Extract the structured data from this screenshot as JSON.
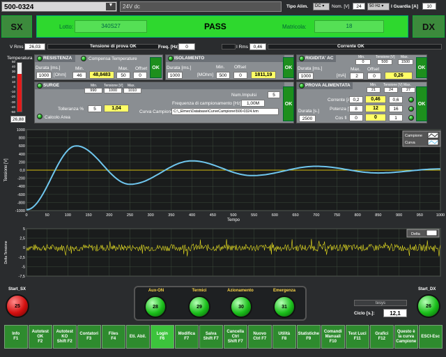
{
  "top": {
    "code": "500-0324",
    "supply": "24V dc",
    "tipo_label": "Tipo Alim.",
    "tipo_val": "DC",
    "nom_label": "Nom. [V]",
    "nom_val": "24",
    "freq_val": "50 Hz",
    "guard_label": "I Guardia [A]",
    "guard_val": "10"
  },
  "bar": {
    "sx": "SX",
    "dx": "DX",
    "lotto_label": "Lotto:",
    "lotto_val": "340S27",
    "result": "PASS",
    "matricola_label": "Matricola:",
    "matricola_val": "18"
  },
  "row3": {
    "vrms_label": "V Rms",
    "vrms_val": "26,03",
    "tens_ok": "Tensione di prova OK",
    "freq_label": "Freq. [Hz]",
    "freq_val": "0",
    "irms_label": "I Rms",
    "irms_val": "0,46",
    "corr_ok": "Corrente OK"
  },
  "temp": {
    "label": "Temperatura",
    "ticks": [
      "50",
      "40",
      "30",
      "20",
      "10",
      "0",
      "-10",
      "-20",
      "-30",
      "-40",
      "-50"
    ],
    "value": "26,88",
    "level": 0.77
  },
  "resistenza": {
    "title": "RESISTENZA",
    "compensa": "Compensa Temperature",
    "durata_label": "Durata [ms.]",
    "ohm": "[Ohm]",
    "min_label": "Min.",
    "max_label": "Max.",
    "offset_label": "Offset",
    "durata": "1000",
    "min": "46",
    "val": "48,8483",
    "max": "50",
    "offset": "0",
    "ok": "OK"
  },
  "isolamento": {
    "title": "ISOLAMENTO",
    "durata_label": "Durata [ms.]",
    "mohm": "[MOhm]",
    "min_label": "Min.",
    "offset_label": "Offset",
    "durata": "1000",
    "min": "500",
    "offset": "0",
    "val": "1811,19",
    "ok": "OK"
  },
  "rigidita": {
    "title": "RIGIDITA' AC",
    "min_label": "Min.",
    "tens_label": "Tensione [V]",
    "max_label": "Max.",
    "min_top": "0",
    "tens": "500",
    "max_top": "1500",
    "durata_label": "Durata [ms.]",
    "ma": "[mA]",
    "max2_label": "Max.",
    "offset_label": "Offset",
    "durata": "1000",
    "max2": "2",
    "offset": "0",
    "val": "0,26",
    "ok": "OK"
  },
  "surge": {
    "title": "SURGE",
    "min_label": "Min.",
    "tens_label": "Tensione [V]",
    "max_label": "Max.",
    "min": "990",
    "tens": "1000",
    "max": "1010",
    "num_label": "Num.Impulsi",
    "num": "5",
    "freq_label": "Frequenza di campionamento [Hz]",
    "freq": "1,00M",
    "toll_label": "Tolleranza %",
    "toll": "5",
    "val": "1,04",
    "curva_label": "Curva Campione",
    "curva": "C:\\_Elmec\\Database\\CurveCampione\\500-0324.lvm",
    "calcolo": "Calcolo Area",
    "ok": "OK"
  },
  "alimentata": {
    "title": "PROVA ALIMENTATA",
    "min_label": "Min.",
    "tens_label": "Tensione [V]",
    "max_label": "Max.",
    "min": "21",
    "tens": "24",
    "max": "27",
    "corr_label": "Corrente [A]",
    "corr": [
      "0,2",
      "0,46",
      "0,6"
    ],
    "pot_label": "Potenza [W]",
    "pot": [
      "8",
      "12",
      "16"
    ],
    "cos_label": "Cos fi",
    "cos": [
      "0",
      "0",
      "1"
    ],
    "durata_label": "Durata [s.]",
    "durata": "2500",
    "ok": "OK"
  },
  "chart_data": [
    {
      "type": "line",
      "ylabel": "Tensione [V]",
      "xlabel": "Tempo",
      "xlim": [
        0,
        1000
      ],
      "ylim": [
        -1000,
        1000
      ],
      "xticks": [
        "0",
        "50",
        "100",
        "150",
        "200",
        "250",
        "300",
        "350",
        "400",
        "450",
        "500",
        "550",
        "600",
        "650",
        "700",
        "750",
        "800",
        "850",
        "900",
        "950",
        "1000"
      ],
      "yticks": [
        "1000",
        "800",
        "600",
        "400",
        "200",
        "0,0",
        "-200",
        "-400",
        "-600",
        "-800",
        "-1000"
      ],
      "legend": [
        "Campione",
        "Curva"
      ],
      "legend_position": "top-right",
      "series": [
        {
          "name": "Curva",
          "peaks": [
            [
              0,
              -980
            ],
            [
              120,
              600
            ],
            [
              250,
              -350
            ],
            [
              400,
              230
            ],
            [
              545,
              -135
            ],
            [
              700,
              95
            ],
            [
              850,
              -70
            ],
            [
              1000,
              30
            ]
          ]
        },
        {
          "name": "Campione",
          "constant": 0
        }
      ]
    },
    {
      "type": "line",
      "ylabel": "Delta Tensione",
      "yticks": [
        "5",
        "2,5",
        "0",
        "-2,5",
        "-5",
        "-7,5"
      ],
      "ylim": [
        -7.5,
        5
      ],
      "legend": [
        "Delta"
      ],
      "legend_position": "top-right"
    }
  ],
  "leds": {
    "start_sx": "Start_SX",
    "start_sx_num": "25",
    "start_dx": "Start_DX",
    "start_dx_num": "26",
    "group": [
      {
        "label": "Aux-ON",
        "num": "28"
      },
      {
        "label": "Termici",
        "num": "29"
      },
      {
        "label": "Azionamento",
        "num": "30"
      },
      {
        "label": "Emergenza",
        "num": "31"
      }
    ],
    "tesys": "tesys",
    "ciclo_label": "Ciclo [s.]:",
    "ciclo": "12,1"
  },
  "fkeys": [
    "Info\nF1",
    "Autotest\nOK\nF2",
    "Autotest\nKO\nShift F2",
    "Contatori\nF3",
    "Files\nF4",
    "Eti. Abil.",
    "Login\nF6",
    "Modifica\nF7",
    "Salva\nShift F7",
    "Cancella\nCtrl\nShift F7",
    "Nuovo\nCtrl F7",
    "Utilità\nF8",
    "Statistiche\nF9",
    "Comandi\nManuali\nF10",
    "Test Luci\nF11",
    "Grafici\nF12",
    "Questo è\nla curva\nCampione",
    "ESCI-Esc"
  ]
}
